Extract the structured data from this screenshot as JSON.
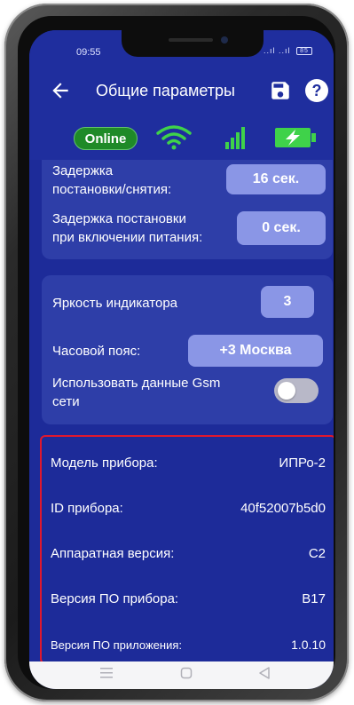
{
  "status_bar": {
    "time": "09:55",
    "signal_text": "..ıl ..ıl",
    "battery_text": "85"
  },
  "toolbar": {
    "title": "Общие параметры",
    "back_icon": "arrow-left-icon",
    "save_icon": "floppy-disk-icon",
    "help_label": "?"
  },
  "connection": {
    "online_label": "Online",
    "online_color": "#1f8a28",
    "wifi_color": "#3fd24a",
    "signal_color": "#3fd24a",
    "battery_color": "#3fd24a"
  },
  "card1": {
    "arm_delay_label_line1": "Задержка",
    "arm_delay_label_line2": "постановки/снятия:",
    "arm_delay_value": "16 сек.",
    "power_delay_label_line1": "Задержка постановки",
    "power_delay_label_line2": "при включении питания:",
    "power_delay_value": "0 сек."
  },
  "card2": {
    "brightness_label": "Яркость индикатора",
    "brightness_value": "3",
    "timezone_label": "Часовой пояс:",
    "timezone_value": "+3 Москва",
    "gsm_label_line1": "Использовать данные Gsm",
    "gsm_label_line2": "сети",
    "gsm_enabled": false
  },
  "device_info": {
    "highlight_color": "#e0182e",
    "rows": [
      {
        "label": "Модель прибора:",
        "value": "ИПРо-2"
      },
      {
        "label": "ID прибора:",
        "value": "40f52007b5d0"
      },
      {
        "label": "Аппаратная версия:",
        "value": "C2"
      },
      {
        "label": "Версия ПО прибора:",
        "value": "B17"
      },
      {
        "label": "Версия ПО приложения:",
        "value": "1.0.10"
      }
    ]
  },
  "navbar": {
    "menu_icon": "menu-icon",
    "home_icon": "home-icon",
    "back_icon": "back-triangle-icon"
  }
}
